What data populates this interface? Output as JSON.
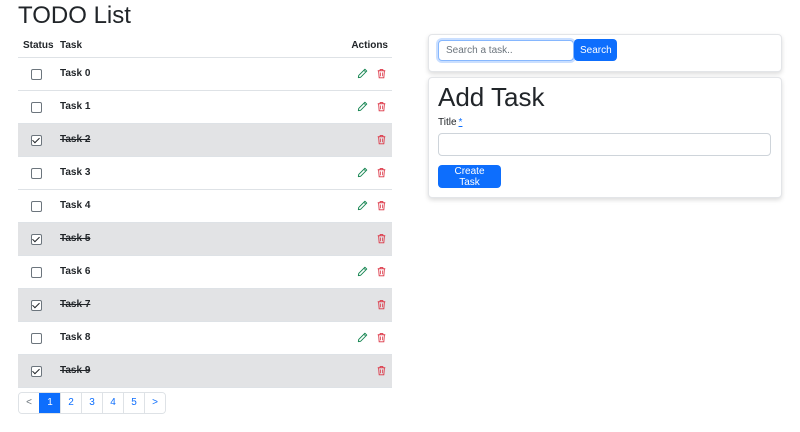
{
  "page": {
    "title": "TODO List"
  },
  "table": {
    "headers": {
      "status": "Status",
      "task": "Task",
      "actions": "Actions"
    },
    "rows": [
      {
        "title": "Task 0",
        "done": false
      },
      {
        "title": "Task 1",
        "done": false
      },
      {
        "title": "Task 2",
        "done": true
      },
      {
        "title": "Task 3",
        "done": false
      },
      {
        "title": "Task 4",
        "done": false
      },
      {
        "title": "Task 5",
        "done": true
      },
      {
        "title": "Task 6",
        "done": false
      },
      {
        "title": "Task 7",
        "done": true
      },
      {
        "title": "Task 8",
        "done": false
      },
      {
        "title": "Task 9",
        "done": true
      }
    ]
  },
  "pagination": {
    "prev": "<",
    "pages": [
      "1",
      "2",
      "3",
      "4",
      "5"
    ],
    "active": "1",
    "next": ">"
  },
  "search": {
    "placeholder": "Search a task..",
    "button": "Search"
  },
  "add_task": {
    "heading": "Add Task",
    "title_label": "Title",
    "required_mark": "*",
    "button": "Create Task"
  },
  "colors": {
    "primary": "#0d6efd",
    "done_row": "#e2e3e5",
    "edit_icon": "#198754",
    "delete_icon": "#dc3545"
  },
  "icons": {
    "edit": "pencil-icon",
    "delete": "trash-icon"
  }
}
